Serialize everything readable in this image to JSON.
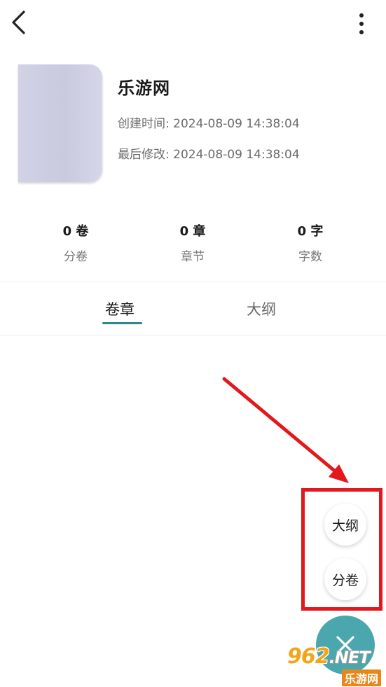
{
  "book": {
    "title": "乐游网",
    "created": "创建时间: 2024-08-09 14:38:04",
    "modified": "最后修改: 2024-08-09 14:38:04"
  },
  "stats": [
    {
      "value": "0 卷",
      "label": "分卷"
    },
    {
      "value": "0 章",
      "label": "章节"
    },
    {
      "value": "0 字",
      "label": "字数"
    }
  ],
  "tabs": [
    {
      "label": "卷章",
      "active": true
    },
    {
      "label": "大纲",
      "active": false
    }
  ],
  "fab_menu": {
    "items": [
      "大纲",
      "分卷"
    ],
    "main_icon": "close-icon"
  },
  "colors": {
    "accent": "#4aa7ad",
    "tab_underline": "#2b8a8a",
    "annotation": "#e3181d"
  },
  "watermark": {
    "top": "962",
    "net": ".NET",
    "bottom": "乐游网"
  }
}
